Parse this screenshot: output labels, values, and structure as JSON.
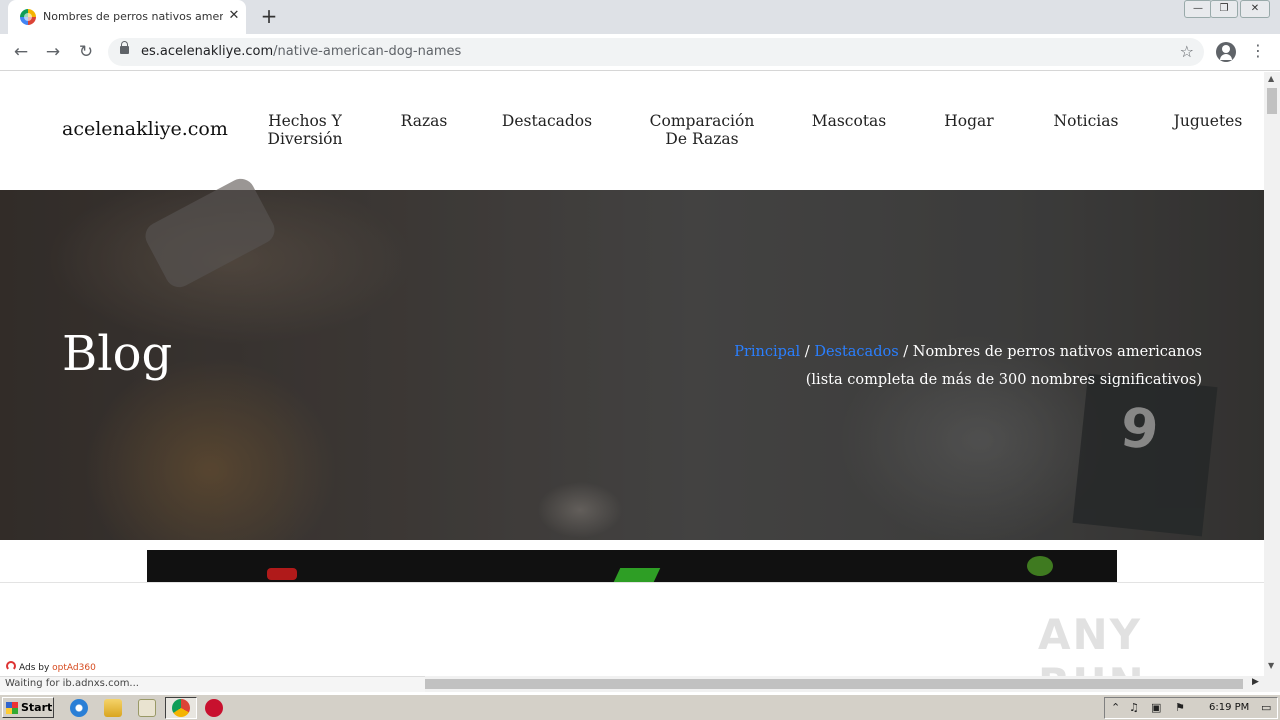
{
  "browser": {
    "tab_title": "Nombres de perros nativos americanos",
    "tab_close": "✕",
    "new_tab": "+",
    "url_domain": "es.acelenakliye.com",
    "url_path": "/native-american-dog-names",
    "back": "←",
    "forward": "→",
    "reload": "↻",
    "star": "☆",
    "menu": "⋮",
    "win_min": "—",
    "win_max": "❐",
    "win_close": "✕"
  },
  "site": {
    "logo": "acelenakliye.com",
    "nav": {
      "hechos": "Hechos Y Diversión",
      "razas": "Razas",
      "destacados": "Destacados",
      "comparacion": "Comparación De Razas",
      "mascotas": "Mascotas",
      "hogar": "Hogar",
      "noticias": "Noticias",
      "juguetes": "Juguetes"
    }
  },
  "hero": {
    "title": "Blog",
    "card_number": "9",
    "breadcrumb": {
      "home": "Principal",
      "sep1": " / ",
      "category": "Destacados",
      "sep2": " / ",
      "current": "Nombres de perros nativos americanos (lista completa de más de 300 nombres significativos)"
    }
  },
  "ads": {
    "ads_by": "Ads by ",
    "brand": "optAd360"
  },
  "status": {
    "text": "Waiting for ib.adnxs.com..."
  },
  "watermark": "ANY RUN",
  "taskbar": {
    "start": "Start",
    "clock": "6:19 PM"
  },
  "colors": {
    "link": "#2a7fff",
    "tabstrip": "#dee1e6",
    "taskbar": "#d4d0c8"
  }
}
